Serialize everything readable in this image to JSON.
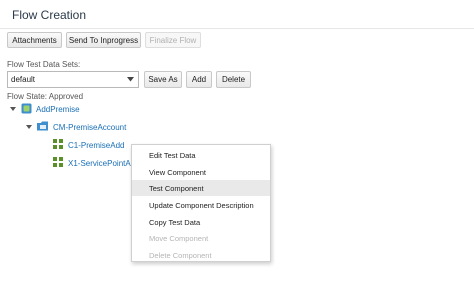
{
  "header": {
    "title": "Flow Creation"
  },
  "toolbar": {
    "attachments": "Attachments",
    "send_to_inprogress": "Send To Inprogress",
    "finalize_flow": "Finalize Flow"
  },
  "test_data_sets": {
    "label": "Flow Test Data Sets:",
    "selected": "default",
    "save_as": "Save As",
    "add": "Add",
    "delete": "Delete"
  },
  "flow_state": "Flow State: Approved",
  "tree": {
    "root": "AddPremise",
    "child": "CM-PremiseAccount",
    "leaves": [
      "C1-PremiseAdd",
      "X1-ServicePointAdd"
    ]
  },
  "context_menu": {
    "items": [
      {
        "label": "Edit Test Data",
        "state": "normal"
      },
      {
        "label": "View Component",
        "state": "normal"
      },
      {
        "label": "Test Component",
        "state": "hover"
      },
      {
        "label": "Update Component Description",
        "state": "normal"
      },
      {
        "label": "Copy Test Data",
        "state": "normal"
      },
      {
        "label": "Move Component",
        "state": "disabled"
      },
      {
        "label": "Delete Component",
        "state": "disabled"
      }
    ]
  },
  "colors": {
    "link": "#1a6fb5",
    "title": "#2b3a4a",
    "icon_green": "#5a8f29",
    "icon_blue": "#3d8fcf"
  }
}
